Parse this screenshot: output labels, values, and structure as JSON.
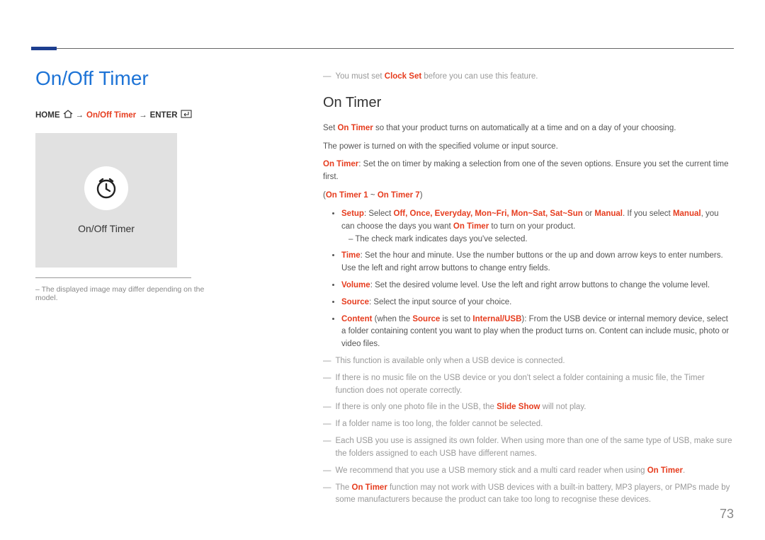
{
  "page_number": "73",
  "left": {
    "title": "On/Off Timer",
    "breadcrumb": {
      "home": "HOME",
      "path": "On/Off Timer",
      "enter": "ENTER"
    },
    "tile_label": "On/Off Timer",
    "disclaimer": "– The displayed image may differ depending on the model."
  },
  "right": {
    "pre_note_prefix": "You must set ",
    "pre_note_bold": "Clock Set",
    "pre_note_suffix": " before you can use this feature.",
    "heading": "On Timer",
    "p1_prefix": "Set ",
    "p1_bold": "On Timer",
    "p1_suffix": " so that your product turns on automatically at a time and on a day of your choosing.",
    "p2": "The power is turned on with the specified volume or input source.",
    "p3_bold": "On Timer",
    "p3_suffix": ": Set the on timer by making a selection from one of the seven options. Ensure you set the current time first.",
    "p4_a": "On Timer 1",
    "p4_mid": " ~ ",
    "p4_b": "On Timer 7",
    "bullets": {
      "setup": {
        "label": "Setup",
        "mid1": ": Select ",
        "opts": "Off, Once, Everyday, Mon~Fri, Mon~Sat, Sat~Sun",
        "mid2": " or ",
        "manual": "Manual",
        "tail1": ". If you select ",
        "tail2": ", you can choose the days you want ",
        "ontimer": "On Timer",
        "tail3": " to turn on your product.",
        "sub": "The check mark indicates days you've selected."
      },
      "time": {
        "label": "Time",
        "text": ": Set the hour and minute. Use the number buttons or the up and down arrow keys to enter numbers. Use the left and right arrow buttons to change entry fields."
      },
      "volume": {
        "label": "Volume",
        "text": ": Set the desired volume level. Use the left and right arrow buttons to change the volume level."
      },
      "source": {
        "label": "Source",
        "text": ": Select the input source of your choice."
      },
      "content": {
        "label": "Content",
        "mid1": " (when the ",
        "source": "Source",
        "mid2": " is set to ",
        "iu": "Internal/USB",
        "tail": "): From the USB device or internal memory device, select a folder containing content you want to play when the product turns on. Content can include music, photo or video files."
      }
    },
    "notes": {
      "n1": "This function is available only when a USB device is connected.",
      "n2": "If there is no music file on the USB device or you don't select a folder containing a music file, the Timer function does not operate correctly.",
      "n3_pre": "If there is only one photo file in the USB, the ",
      "n3_bold": "Slide Show",
      "n3_suf": " will not play.",
      "n4": "If a folder name is too long, the folder cannot be selected.",
      "n5": "Each USB you use is assigned its own folder. When using more than one of the same type of USB, make sure the folders assigned to each USB have different names.",
      "n6_pre": "We recommend that you use a USB memory stick and a multi card reader when using ",
      "n6_bold": "On Timer",
      "n6_suf": ".",
      "n7_pre": "The ",
      "n7_bold": "On Timer",
      "n7_suf": " function may not work with USB devices with a built-in battery, MP3 players, or PMPs made by some manufacturers because the product can take too long to recognise these devices."
    }
  }
}
